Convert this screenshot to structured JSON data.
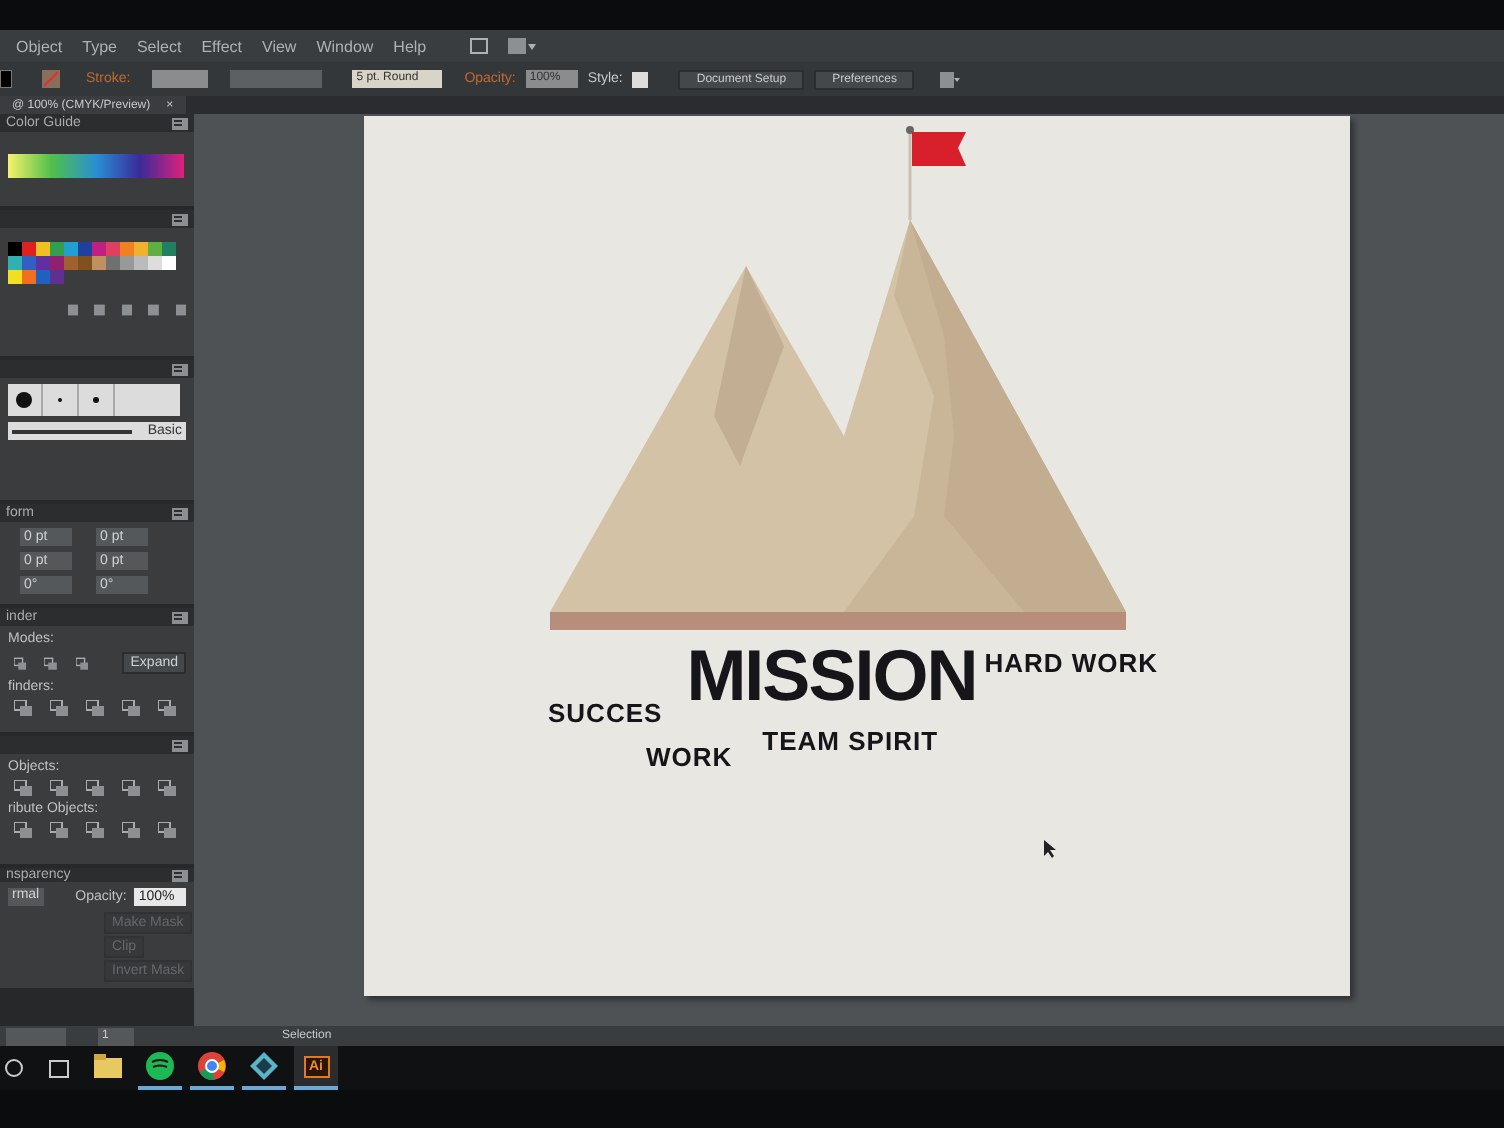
{
  "menu": [
    "Object",
    "Type",
    "Select",
    "Effect",
    "View",
    "Window",
    "Help"
  ],
  "control_bar": {
    "stroke_label": "Stroke:",
    "brush": "5 pt. Round",
    "opacity_label": "Opacity:",
    "opacity": "100%",
    "style_label": "Style:",
    "buttons": [
      "Document Setup",
      "Preferences"
    ]
  },
  "document_tab": {
    "title": "@ 100% (CMYK/Preview)",
    "close": "×"
  },
  "panels": [
    {
      "kind": "color_guide",
      "title": "Color Guide"
    },
    {
      "kind": "swatches"
    },
    {
      "kind": "brushes",
      "brush_name": "Basic"
    },
    {
      "kind": "transform",
      "title": "form",
      "fields": [
        "0 pt",
        "0 pt",
        "0 pt",
        "0 pt",
        "0°",
        "0°"
      ]
    },
    {
      "kind": "pathfinder",
      "title": "inder",
      "sections": [
        {
          "label": "Modes:",
          "button": "Expand"
        },
        {
          "label": "finders:"
        }
      ]
    },
    {
      "kind": "align",
      "sections": [
        {
          "label": "Objects:"
        },
        {
          "label": "ribute Objects:"
        }
      ]
    },
    {
      "kind": "transparency",
      "title": "nsparency",
      "blend_mode": "rmal",
      "opacity_label": "Opacity:",
      "opacity": "100%",
      "buttons": [
        {
          "label": "Make Mask",
          "disabled": true
        },
        {
          "label": "Clip",
          "disabled": true
        },
        {
          "label": "Invert Mask",
          "disabled": true
        }
      ]
    }
  ],
  "artboard": {
    "words": [
      {
        "text": "SUCCES",
        "kind": "word"
      },
      {
        "text": "MISSION",
        "kind": "title"
      },
      {
        "text": "HARD WORK",
        "kind": "word"
      },
      {
        "text": "WORK",
        "kind": "word"
      },
      {
        "text": "TEAM SPIRIT",
        "kind": "word"
      }
    ]
  },
  "status_bar": {
    "page": "1",
    "tool": "Selection"
  },
  "taskbar": [
    {
      "kind": "folder",
      "running": false,
      "selected": false
    },
    {
      "kind": "green",
      "running": true,
      "selected": false
    },
    {
      "kind": "browser",
      "running": true,
      "selected": false
    },
    {
      "kind": "diamond",
      "running": true,
      "selected": false
    },
    {
      "kind": "ai",
      "label": "Ai",
      "running": true,
      "selected": true
    }
  ]
}
